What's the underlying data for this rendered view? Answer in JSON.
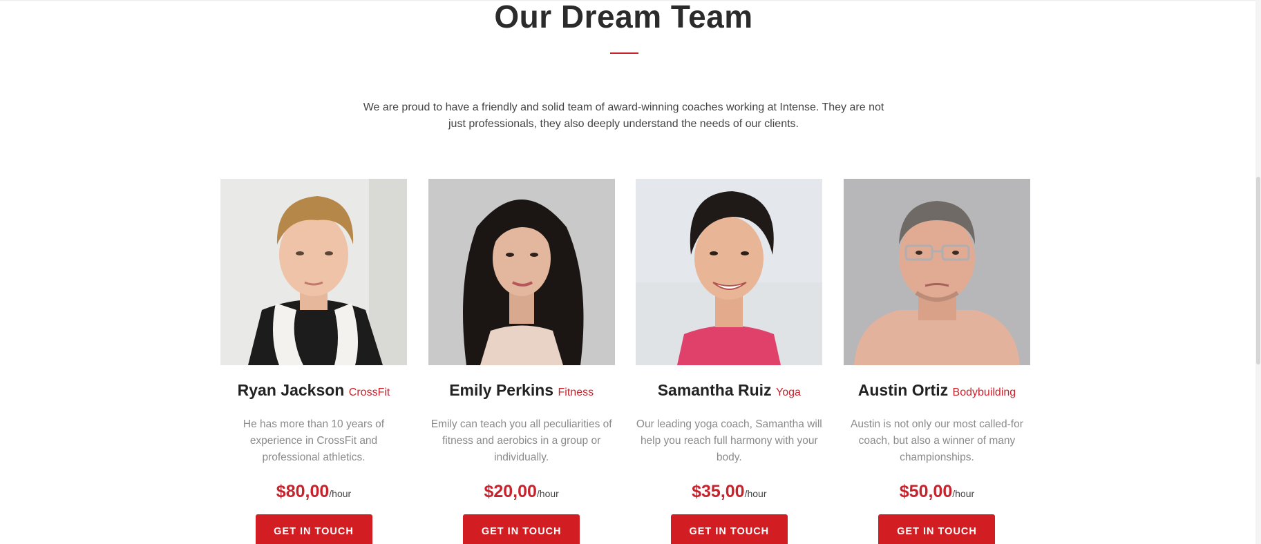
{
  "section": {
    "title": "Our Dream Team",
    "intro": "We are proud to have a friendly and solid team of award-winning coaches working at Intense. They are not just professionals, they also deeply understand the needs of our clients.",
    "accent_color": "#c8232c"
  },
  "team": [
    {
      "name": "Ryan Jackson",
      "specialty": "CrossFit",
      "bio": "He has more than 10 years of experience in CrossFit and professional athletics.",
      "price": "$80,00",
      "unit": "/hour",
      "cta": "GET IN TOUCH"
    },
    {
      "name": "Emily Perkins",
      "specialty": "Fitness",
      "bio": "Emily can teach you all peculiarities of fitness and aerobics in a group or individually.",
      "price": "$20,00",
      "unit": "/hour",
      "cta": "GET IN TOUCH"
    },
    {
      "name": "Samantha Ruiz",
      "specialty": "Yoga",
      "bio": "Our leading yoga coach, Samantha will help you reach full harmony with your body.",
      "price": "$35,00",
      "unit": "/hour",
      "cta": "GET IN TOUCH"
    },
    {
      "name": "Austin Ortiz",
      "specialty": "Bodybuilding",
      "bio": "Austin is not only our most called-for coach, but also a winner of many championships.",
      "price": "$50,00",
      "unit": "/hour",
      "cta": "GET IN TOUCH"
    }
  ]
}
